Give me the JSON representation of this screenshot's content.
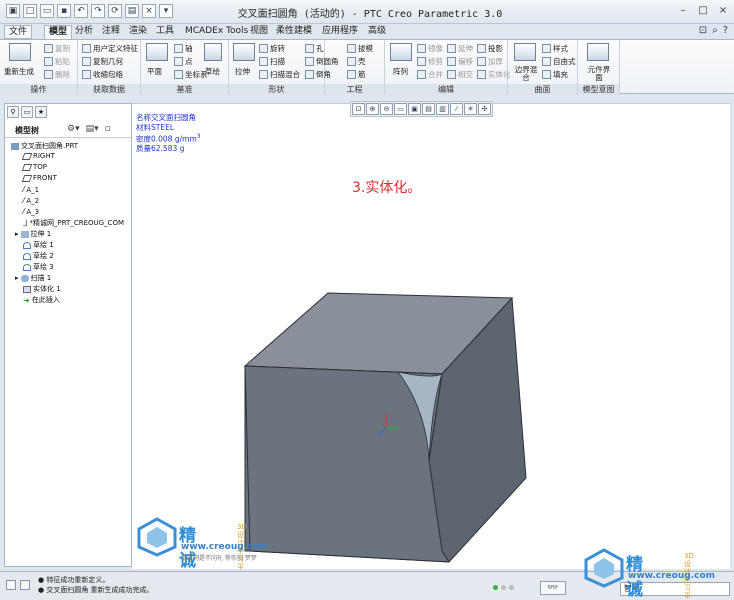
{
  "window": {
    "title": "交叉面扫圆角 (活动的) - PTC Creo Parametric 3.0"
  },
  "menu_tabs": [
    "文件",
    "模型",
    "分析",
    "注释",
    "渲染",
    "工具",
    "MCADEx Tools",
    "视图",
    "柔性建模",
    "应用程序",
    "高级"
  ],
  "active_tab": "模型",
  "ribbon": {
    "groups": [
      {
        "label": "操作",
        "items": [
          "重新生成",
          "复制",
          "粘贴",
          "删除"
        ]
      },
      {
        "label": "获取数据",
        "items": [
          "用户定义特征",
          "复制几何",
          "收缩包络"
        ]
      },
      {
        "label": "基准",
        "items": [
          "平面",
          "轴",
          "点",
          "坐标系",
          "草绘"
        ]
      },
      {
        "label": "形状",
        "items": [
          "拉伸",
          "旋转",
          "扫描",
          "扫描混合"
        ]
      },
      {
        "label": "工程",
        "items": [
          "孔",
          "倒圆角",
          "倒角",
          "拔模",
          "壳",
          "筋"
        ]
      },
      {
        "label": "编辑",
        "items": [
          "阵列",
          "镜像",
          "延伸",
          "投影",
          "修剪",
          "偏移",
          "加厚",
          "合并",
          "相交",
          "实体化"
        ]
      },
      {
        "label": "曲面",
        "items": [
          "边界混合",
          "样式",
          "自由式",
          "填充"
        ]
      },
      {
        "label": "模型意图",
        "items": [
          "元件界面"
        ]
      }
    ]
  },
  "model_tree": {
    "title": "模型树",
    "nodes": [
      {
        "label": "交叉面扫圆角.PRT",
        "level": 0,
        "icon": "part-icon"
      },
      {
        "label": "RIGHT",
        "level": 1,
        "icon": "datum-plane-icon"
      },
      {
        "label": "TOP",
        "level": 1,
        "icon": "datum-plane-icon"
      },
      {
        "label": "FRONT",
        "level": 1,
        "icon": "datum-plane-icon"
      },
      {
        "label": "A_1",
        "level": 1,
        "icon": "axis-icon"
      },
      {
        "label": "A_2",
        "level": 1,
        "icon": "axis-icon"
      },
      {
        "label": "A_3",
        "level": 1,
        "icon": "axis-icon"
      },
      {
        "label": "*精诚网_PRT_CREOUG_COM",
        "level": 1,
        "icon": "csys-icon"
      },
      {
        "label": "拉伸 1",
        "level": 1,
        "icon": "extrude-icon",
        "expandable": true
      },
      {
        "label": "草绘 1",
        "level": 1,
        "icon": "sketch-icon"
      },
      {
        "label": "草绘 2",
        "level": 1,
        "icon": "sketch-icon"
      },
      {
        "label": "草绘 3",
        "level": 1,
        "icon": "sketch-icon"
      },
      {
        "label": "扫描 1",
        "level": 1,
        "icon": "sweep-icon",
        "expandable": true
      },
      {
        "label": "实体化 1",
        "level": 1,
        "icon": "solidify-icon"
      },
      {
        "label": "在此插入",
        "level": 1,
        "icon": "insert-here-icon"
      }
    ]
  },
  "properties": {
    "name": "名称交叉面扫圆角",
    "material": "材料STEEL",
    "density": "密度0.008 g/mm",
    "density_exp": "3",
    "mass": "质量62.583 g"
  },
  "annotation": "3.实体化。",
  "status": {
    "messages": [
      "● 特征成功重新定义。",
      "● 交叉面扫圆角 重新生成成功完成。"
    ],
    "selection_filter": "智能"
  },
  "watermark": {
    "name": "精诚网",
    "sub_line1": "3D设计",
    "sub_line2": "学习平台",
    "url": "www.creoug.com",
    "slogan": "精诚网是不问礼 等你创 梦梦"
  }
}
